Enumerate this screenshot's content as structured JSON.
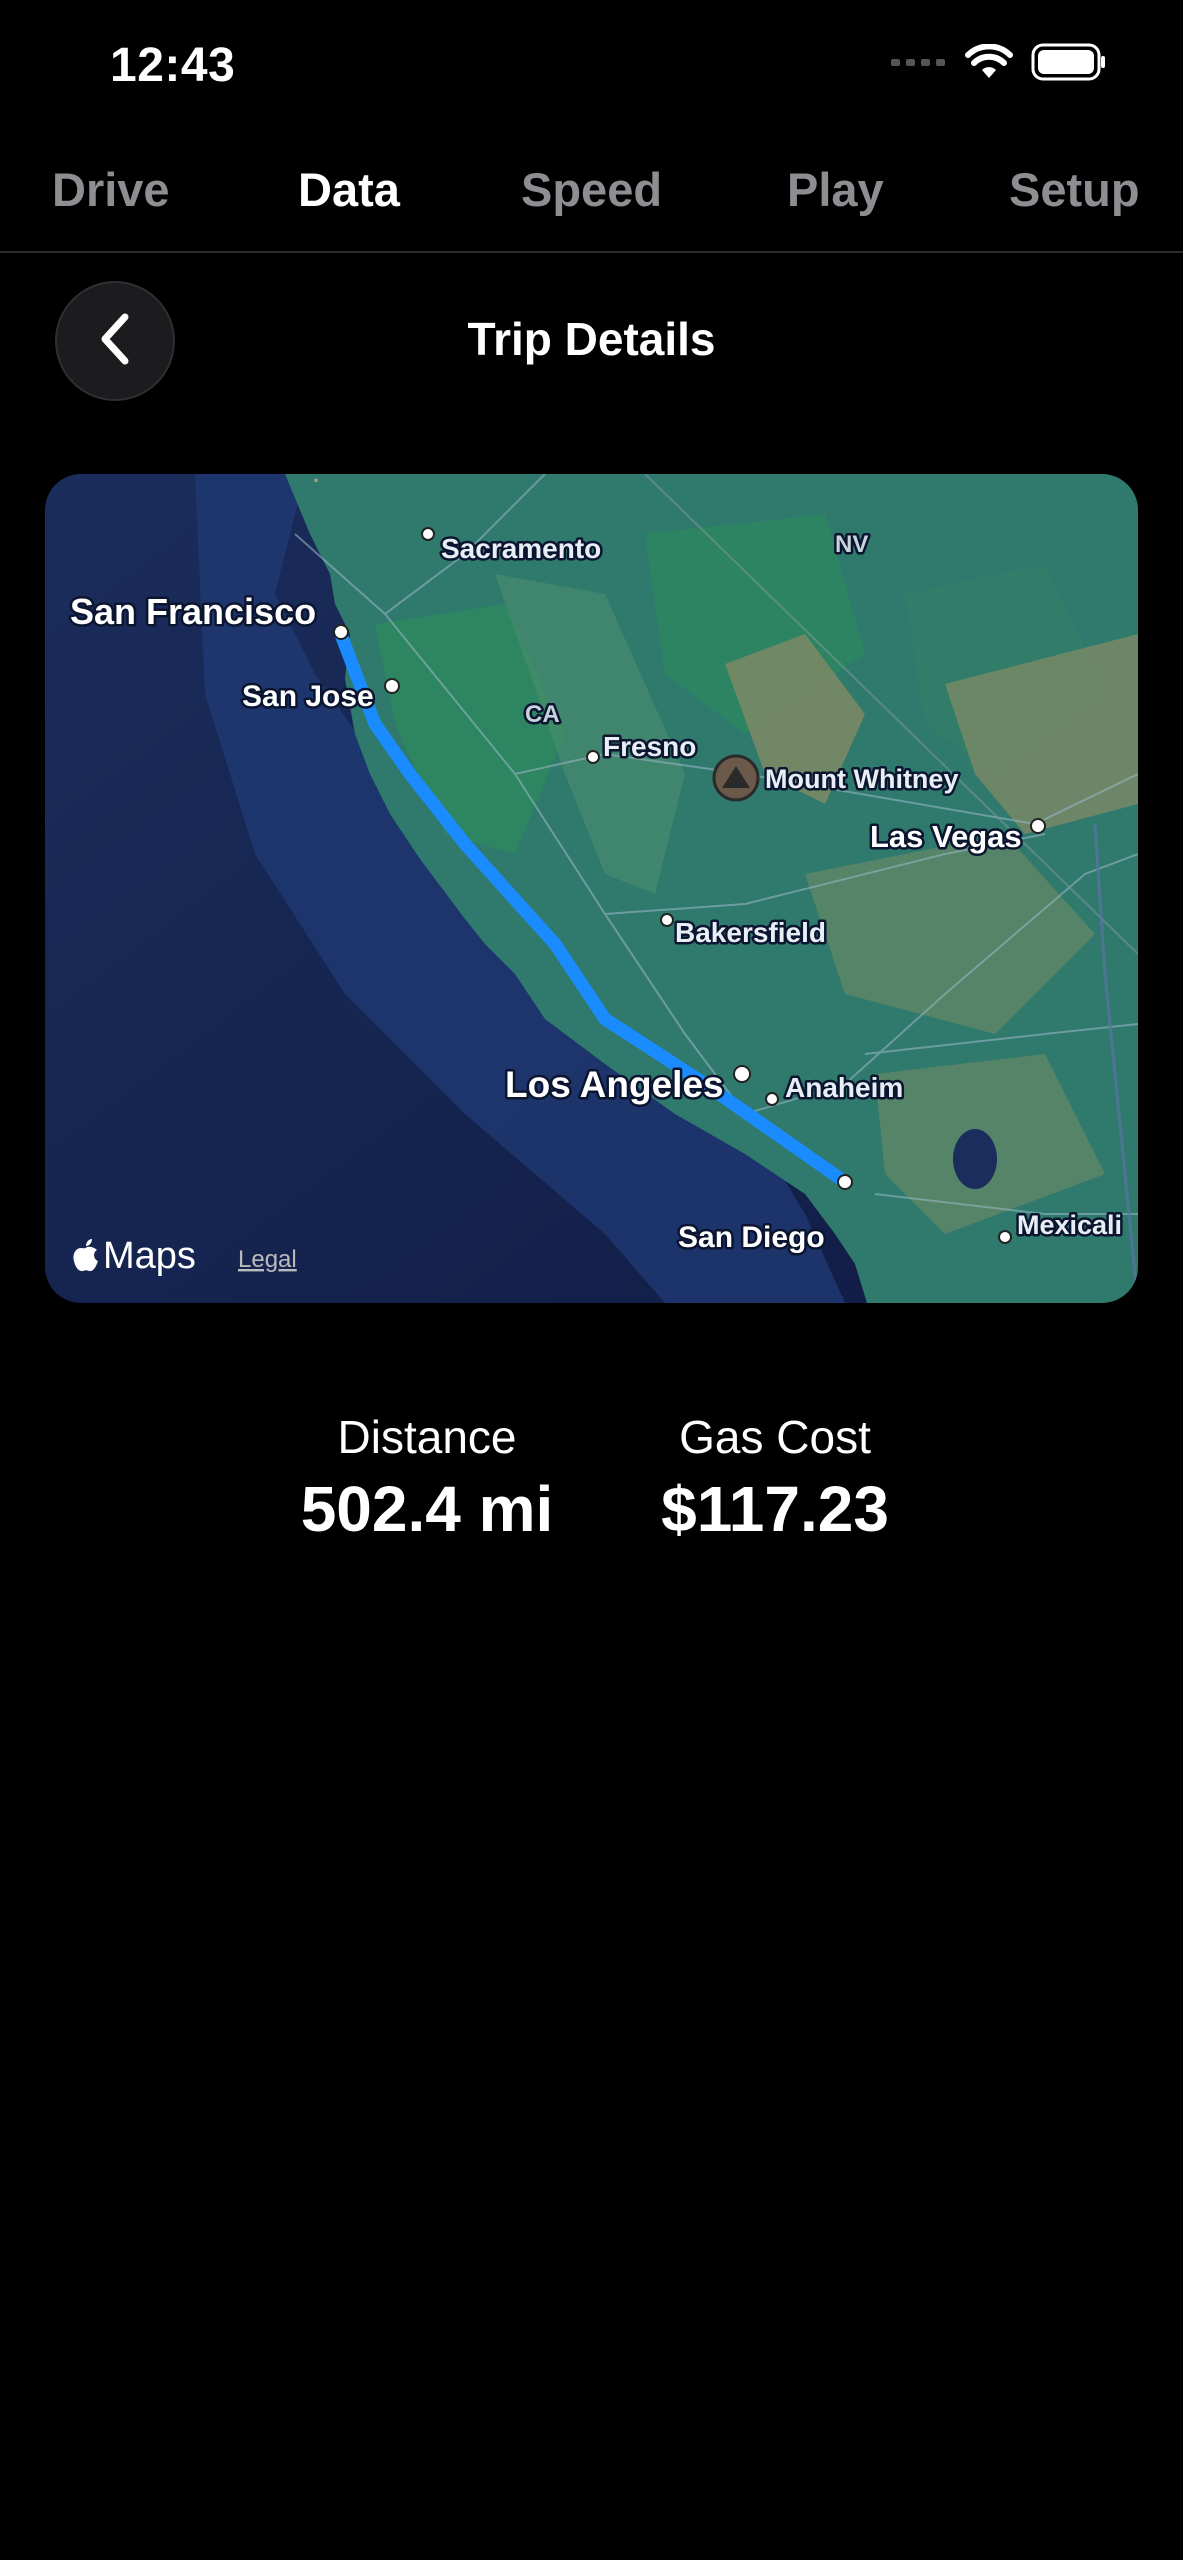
{
  "status_bar": {
    "time": "12:43"
  },
  "tabs": [
    {
      "label": "Drive",
      "active": false
    },
    {
      "label": "Data",
      "active": true
    },
    {
      "label": "Speed",
      "active": false
    },
    {
      "label": "Play",
      "active": false
    },
    {
      "label": "Setup",
      "active": false
    }
  ],
  "header": {
    "title": "Trip Details"
  },
  "map": {
    "labels": {
      "sacramento": "Sacramento",
      "nv": "NV",
      "san_francisco": "San Francisco",
      "san_jose": "San Jose",
      "ca": "CA",
      "fresno": "Fresno",
      "mount_whitney": "Mount Whitney",
      "las_vegas": "Las Vegas",
      "bakersfield": "Bakersfield",
      "los_angeles": "Los Angeles",
      "anaheim": "Anaheim",
      "san_diego": "San Diego",
      "mexicali": "Mexicali"
    },
    "brand": "Maps",
    "legal": "Legal",
    "route_color": "#1a8cff"
  },
  "stats": {
    "distance": {
      "label": "Distance",
      "value": "502.4 mi"
    },
    "gas_cost": {
      "label": "Gas Cost",
      "value": "$117.23"
    }
  }
}
